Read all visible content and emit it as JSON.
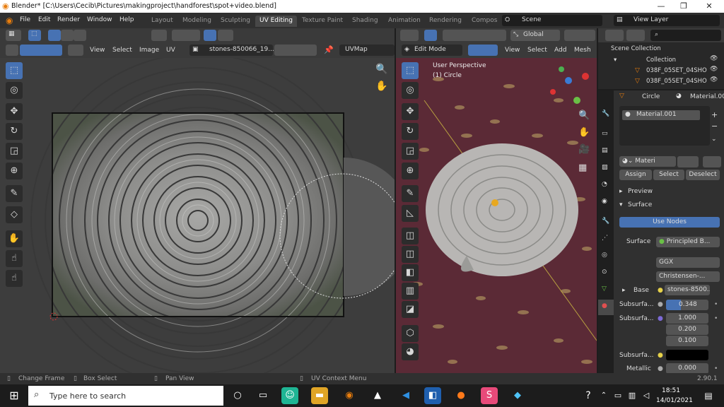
{
  "window": {
    "title": "Blender* [C:\\Users\\Cecib\\Pictures\\makingproject\\handforest\\spot+video.blend]",
    "minimize": "—",
    "maximize": "❐",
    "close": "✕"
  },
  "menu": {
    "items": [
      "File",
      "Edit",
      "Render",
      "Window",
      "Help"
    ],
    "workspaces": [
      "Layout",
      "Modeling",
      "Sculpting",
      "UV Editing",
      "Texture Paint",
      "Shading",
      "Animation",
      "Rendering",
      "Compos"
    ],
    "active_workspace": "UV Editing",
    "scene": "Scene",
    "view_layer": "View Layer"
  },
  "uv_editor": {
    "menus": [
      "View",
      "Select",
      "Image",
      "UV"
    ],
    "image_name": "stones-850066_19...",
    "uvmap": "UVMap"
  },
  "viewport": {
    "mode": "Edit Mode",
    "orientation": "Global",
    "menus": [
      "View",
      "Select",
      "Add",
      "Mesh"
    ],
    "overlay_line1": "User Perspective",
    "overlay_line2": "(1) Circle"
  },
  "outliner": {
    "root": "Scene Collection",
    "collection": "Collection",
    "items": [
      "038F_05SET_04SHO",
      "038F_05SET_04SHO"
    ]
  },
  "properties": {
    "object": "Circle",
    "material_tab": "Material.00",
    "slot": "Material.001",
    "material_field": "Materi",
    "assign": "Assign",
    "select": "Select",
    "deselect": "Deselect",
    "preview": "Preview",
    "surface_panel": "Surface",
    "use_nodes": "Use Nodes",
    "surface_label": "Surface",
    "surface_value": "Principled B...",
    "distribution": "GGX",
    "subsurface_method": "Christensen-...",
    "base_label": "Base",
    "base_value": "stones-8500...",
    "subsurface1_label": "Subsurfa...",
    "subsurface1_value": "0.348",
    "subsurface2_label": "Subsurfa...",
    "radius": [
      "1.000",
      "0.200",
      "0.100"
    ],
    "subsurface3_label": "Subsurfa...",
    "metallic_label": "Metallic",
    "metallic_value": "0.000"
  },
  "status": {
    "change_frame": "Change Frame",
    "box_select": "Box Select",
    "pan_view": "Pan View",
    "uv_context": "UV Context Menu",
    "version": "2.90.1"
  },
  "taskbar": {
    "search_placeholder": "Type here to search",
    "time": "18:51",
    "date": "14/01/2021"
  }
}
